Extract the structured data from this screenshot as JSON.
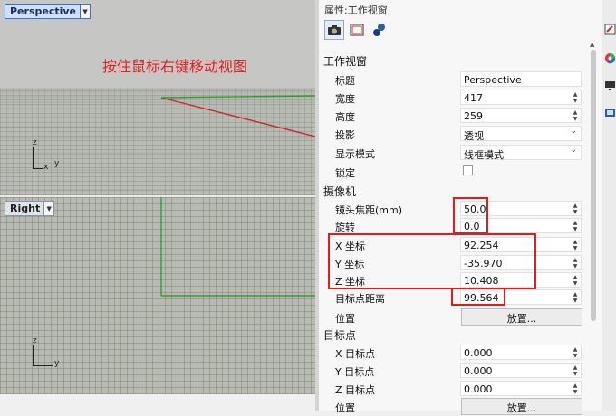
{
  "viewports": {
    "top": {
      "name": "Perspective",
      "overlay_text": "按住鼠标右键移动视图",
      "axis_z": "z",
      "axis_x": "x",
      "axis_y": "y"
    },
    "bottom": {
      "name": "Right",
      "axis_z": "z",
      "axis_y": "y"
    }
  },
  "panel": {
    "title": "属性:工作视窗",
    "sections": {
      "viewport": "工作视窗",
      "camera": "摄像机",
      "target": "目标点"
    },
    "viewport_props": {
      "title_label": "标题",
      "title_value": "Perspective",
      "width_label": "宽度",
      "width_value": "417",
      "height_label": "高度",
      "height_value": "259",
      "projection_label": "投影",
      "projection_value": "透视",
      "display_label": "显示模式",
      "display_value": "线框模式",
      "lock_label": "锁定"
    },
    "camera_props": {
      "lens_label": "镜头焦距(mm)",
      "lens_value": "50.0",
      "rotation_label": "旋转",
      "rotation_value": "0.0",
      "x_label": "X 坐标",
      "x_value": "92.254",
      "y_label": "Y 坐标",
      "y_value": "-35.970",
      "z_label": "Z 坐标",
      "z_value": "10.408",
      "target_dist_label": "目标点距离",
      "target_dist_value": "99.564",
      "position_label": "位置",
      "place_button": "放置..."
    },
    "target_props": {
      "x_label": "X 目标点",
      "x_value": "0.000",
      "y_label": "Y 目标点",
      "y_value": "0.000",
      "z_label": "Z 目标点",
      "z_value": "0.000",
      "position_label": "位置",
      "place_button": "放置..."
    }
  },
  "colors": {
    "highlight": "#e21b1b",
    "active_tab": "#3b6fd0",
    "x_axis": "#d03030",
    "y_axis": "#2aa02a"
  }
}
